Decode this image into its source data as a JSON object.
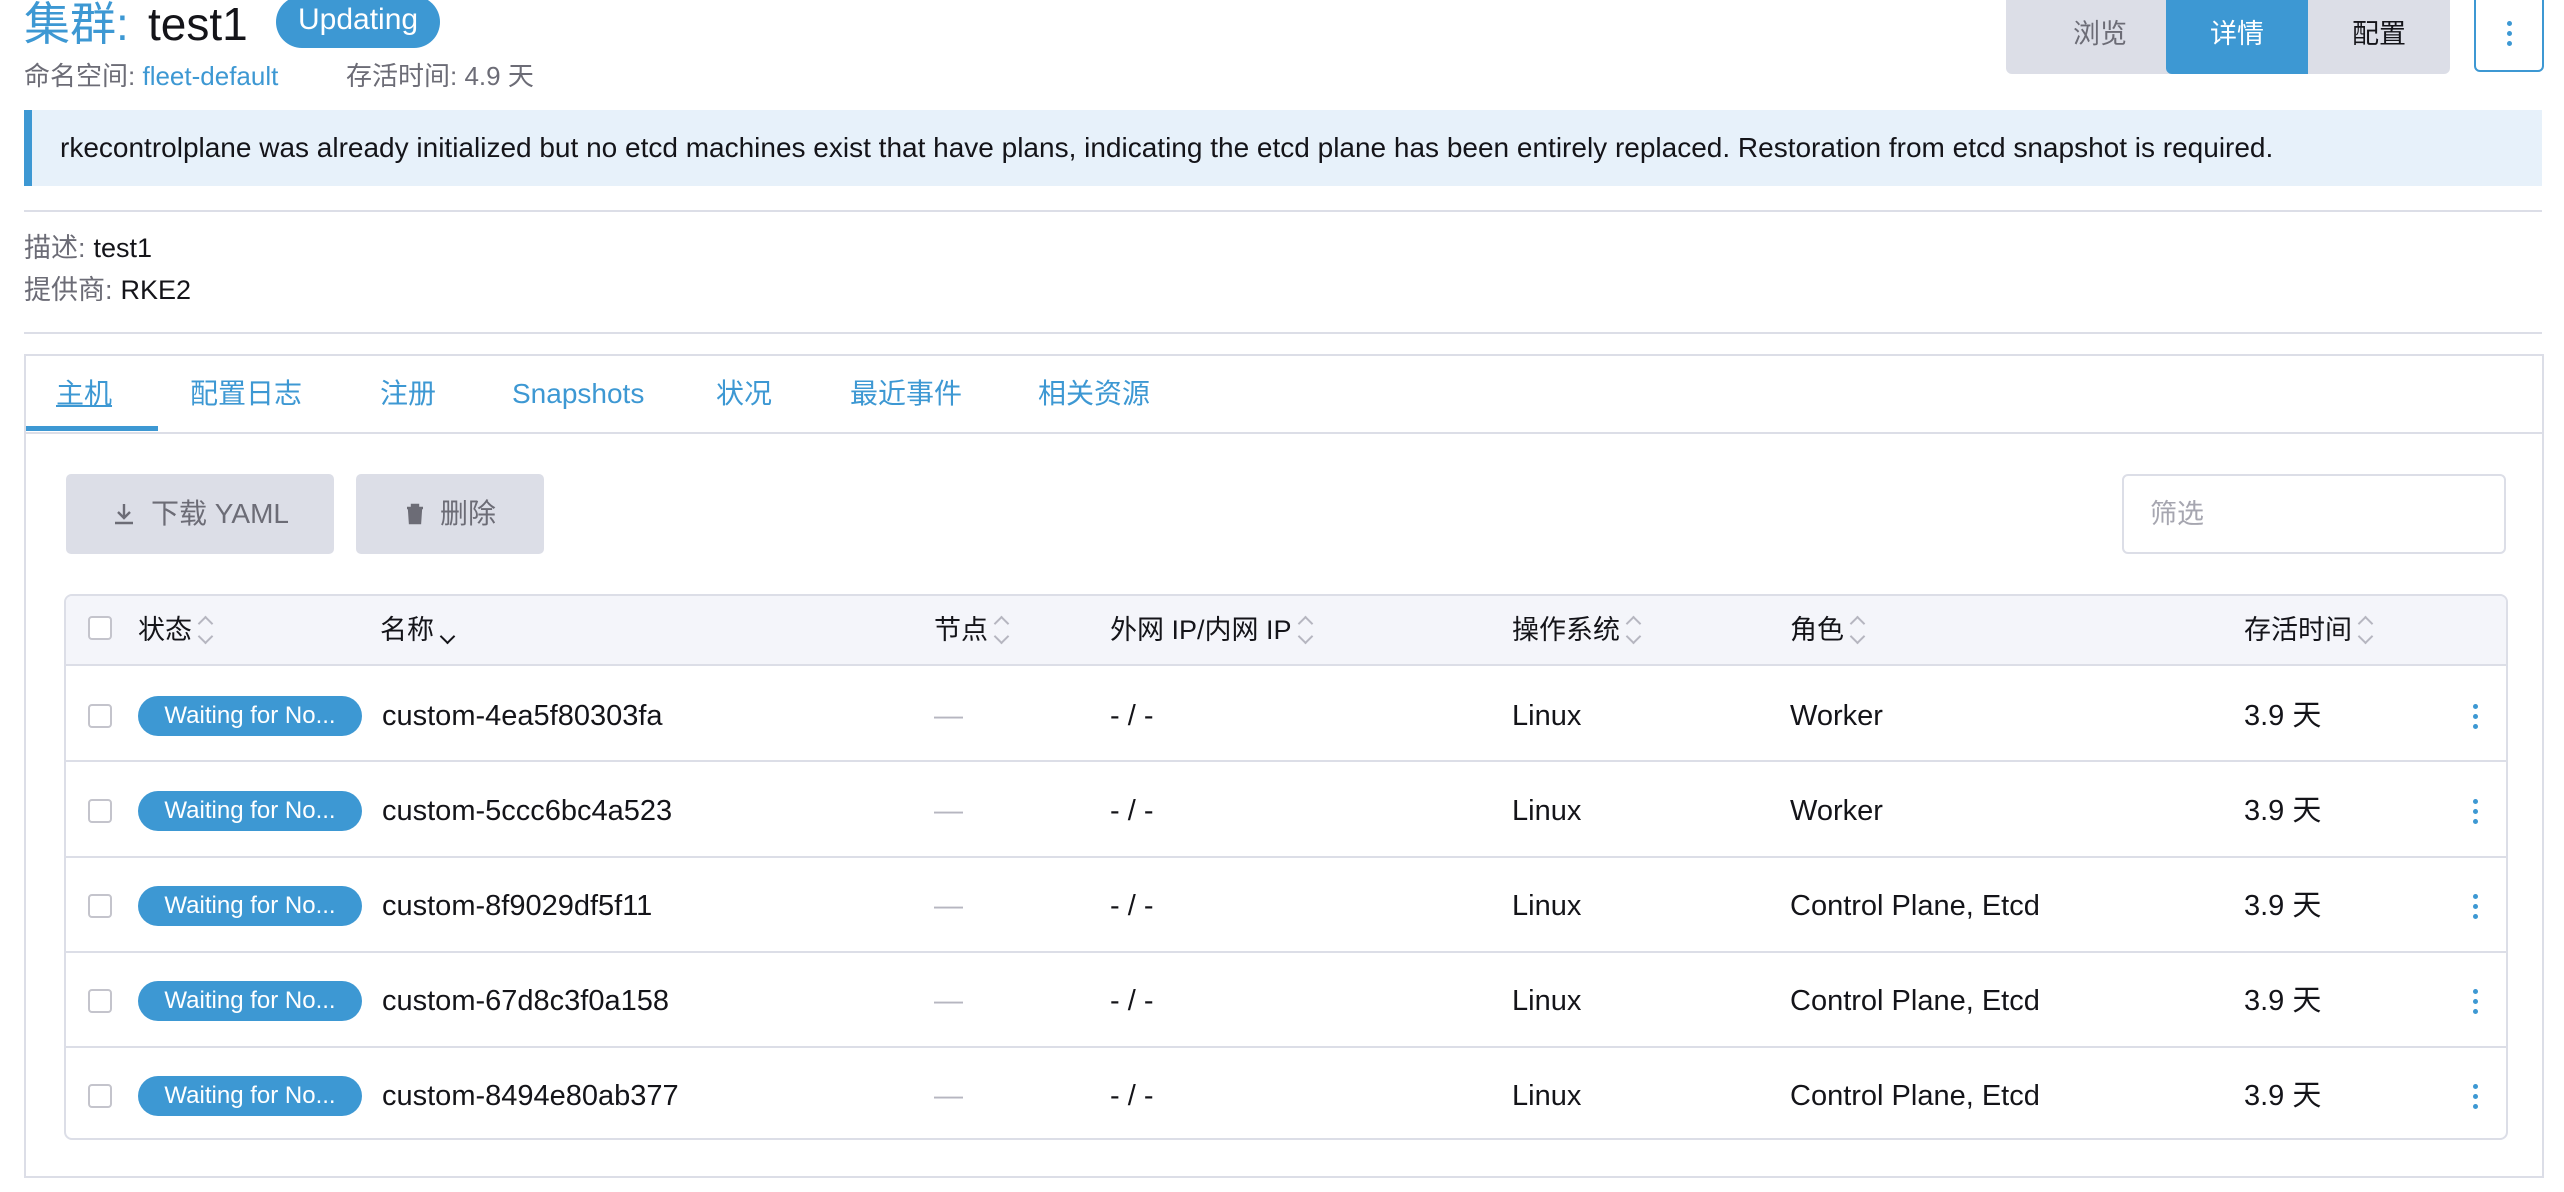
{
  "header": {
    "title_prefix": "集群:",
    "title_name": "test1",
    "state_badge": "Updating",
    "namespace_label": "命名空间:",
    "namespace_value": "fleet-default",
    "age_label": "存活时间:",
    "age_value": "4.9 天",
    "buttons": {
      "browse": "浏览",
      "detail": "详情",
      "config": "配置"
    }
  },
  "banner": {
    "message": "rkecontrolplane was already initialized but no etcd machines exist that have plans, indicating the etcd plane has been entirely replaced. Restoration from etcd snapshot is required."
  },
  "details": {
    "description_label": "描述:",
    "description_value": "test1",
    "provider_label": "提供商:",
    "provider_value": "RKE2"
  },
  "tabs": [
    "主机",
    "配置日志",
    "注册",
    "Snapshots",
    "状况",
    "最近事件",
    "相关资源"
  ],
  "toolbar": {
    "download_label": "下载 YAML",
    "delete_label": "删除",
    "filter_placeholder": "筛选"
  },
  "table": {
    "columns": [
      "状态",
      "名称",
      "节点",
      "外网 IP/内网 IP",
      "操作系统",
      "角色",
      "存活时间"
    ],
    "rows": [
      {
        "status": "Waiting for No...",
        "name": "custom-4ea5f80303fa",
        "node": "—",
        "ip": "- / -",
        "os": "Linux",
        "role": "Worker",
        "age": "3.9 天"
      },
      {
        "status": "Waiting for No...",
        "name": "custom-5ccc6bc4a523",
        "node": "—",
        "ip": "- / -",
        "os": "Linux",
        "role": "Worker",
        "age": "3.9 天"
      },
      {
        "status": "Waiting for No...",
        "name": "custom-8f9029df5f11",
        "node": "—",
        "ip": "- / -",
        "os": "Linux",
        "role": "Control Plane, Etcd",
        "age": "3.9 天"
      },
      {
        "status": "Waiting for No...",
        "name": "custom-67d8c3f0a158",
        "node": "—",
        "ip": "- / -",
        "os": "Linux",
        "role": "Control Plane, Etcd",
        "age": "3.9 天"
      },
      {
        "status": "Waiting for No...",
        "name": "custom-8494e80ab377",
        "node": "—",
        "ip": "- / -",
        "os": "Linux",
        "role": "Control Plane, Etcd",
        "age": "3.9 天"
      }
    ]
  },
  "colors": {
    "accent": "#3d98d3",
    "banner_bg": "#e7f1fa",
    "border": "#dcdee7"
  },
  "icons": {
    "download": "download-icon",
    "delete": "trash-icon",
    "more": "vertical-dots-icon"
  }
}
